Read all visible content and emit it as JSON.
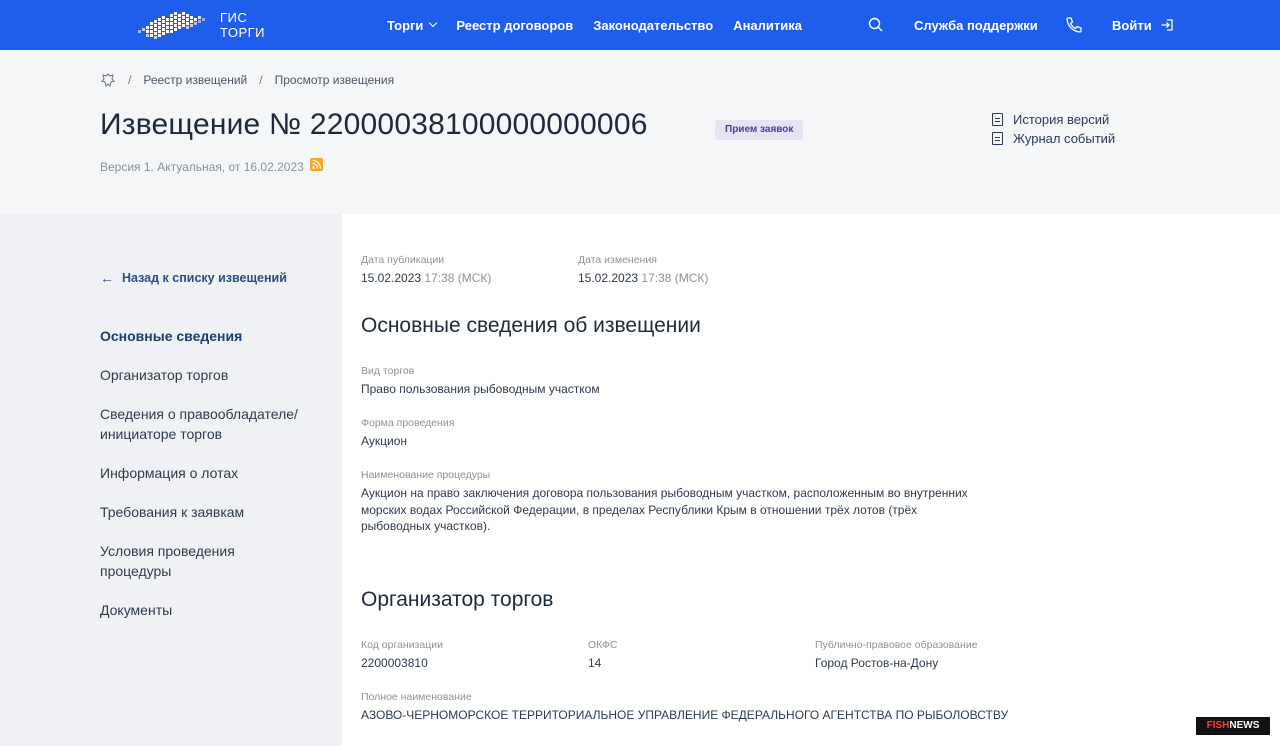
{
  "header": {
    "logo_line1": "ГИС",
    "logo_line2": "ТОРГИ",
    "nav": [
      "Торги",
      "Реестр договоров",
      "Законодательство",
      "Аналитика"
    ],
    "support": "Служба поддержки",
    "login": "Войти"
  },
  "breadcrumb": [
    "Реестр извещений",
    "Просмотр извещения"
  ],
  "notice": {
    "title": "Извещение № 22000038100000000006",
    "status": "Прием заявок",
    "version": "Версия 1. Актуальная, от 16.02.2023",
    "history": "История версий",
    "journal": "Журнал событий"
  },
  "sidebar": {
    "back": "Назад к списку извещений",
    "items": [
      "Основные сведения",
      "Организатор торгов",
      "Сведения о правообладателе/ инициаторе торгов",
      "Информация о лотах",
      "Требования к заявкам",
      "Условия проведения процедуры",
      "Документы"
    ]
  },
  "main": {
    "pub_label": "Дата публикации",
    "pub_date": "15.02.2023",
    "pub_time": "17:38 (МСК)",
    "mod_label": "Дата изменения",
    "mod_date": "15.02.2023",
    "mod_time": "17:38 (МСК)",
    "section1": "Основные сведения об извещении",
    "kind_label": "Вид торгов",
    "kind": "Право пользования рыбоводным участком",
    "form_label": "Форма проведения",
    "form": "Аукцион",
    "name_label": "Наименование процедуры",
    "name": "Аукцион на право заключения договора пользования рыбоводным участком, расположенным во внутренних морских водах Российской Федерации, в пределах Республики Крым в отношении трёх лотов (трёх рыбоводных участков).",
    "section2": "Организатор торгов",
    "code_label": "Код организации",
    "code": "2200003810",
    "okfs_label": "ОКФС",
    "okfs": "14",
    "ppo_label": "Публично-правовое образование",
    "ppo": "Город Ростов-на-Дону",
    "fullname_label": "Полное наименование",
    "fullname": "АЗОВО-ЧЕРНОМОРСКОЕ ТЕРРИТОРИАЛЬНОЕ УПРАВЛЕНИЕ ФЕДЕРАЛЬНОГО АГЕНТСТВА ПО РЫБОЛОВСТВУ"
  },
  "watermark": {
    "part1": "FISH",
    "part2": "NEWS"
  },
  "colors": {
    "topbar": "#1e5eea",
    "header_bg": "#f5f6f8",
    "sidebar_bg": "#f0f1f4",
    "badge_bg": "#e5e4f4"
  }
}
